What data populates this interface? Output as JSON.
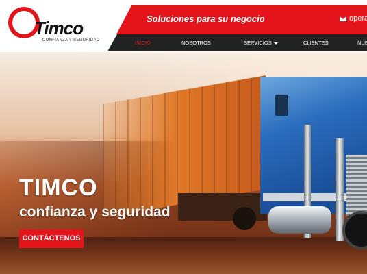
{
  "header": {
    "logo": {
      "name": "Timco",
      "tagline": "CONFIANZA Y SEGURIDAD"
    },
    "slogan": "Soluciones para su negocio",
    "contact_text": "opera"
  },
  "nav": {
    "items": [
      {
        "label": "INICIO",
        "active": true
      },
      {
        "label": "NOSOTROS"
      },
      {
        "label": "SERVICIOS",
        "has_dropdown": true
      },
      {
        "label": "CLIENTES"
      },
      {
        "label": "NUE"
      }
    ]
  },
  "hero": {
    "title": "TIMCO",
    "subtitle": "confianza y seguridad",
    "cta_label": "CONTÁCTENOS"
  },
  "colors": {
    "brand_red": "#e4141b",
    "nav_bg": "#222222"
  }
}
